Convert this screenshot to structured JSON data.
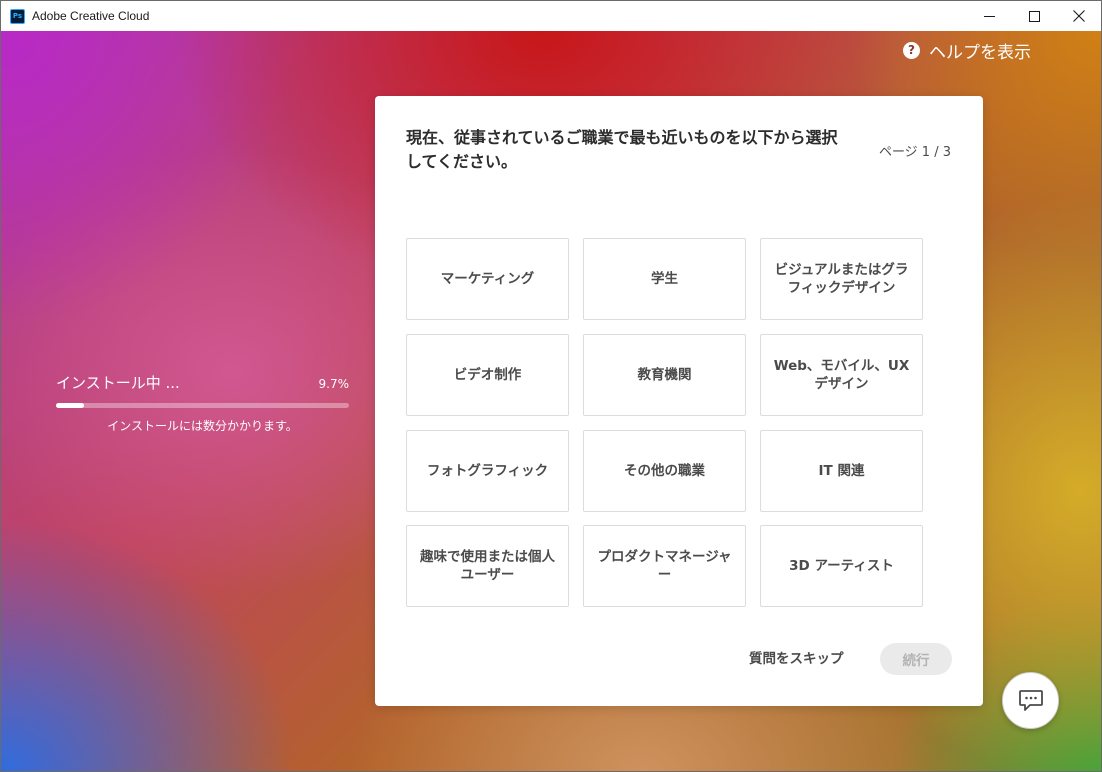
{
  "window": {
    "title": "Adobe Creative Cloud",
    "app_icon_text": "Ps"
  },
  "header": {
    "help_icon_glyph": "?",
    "help_label": "ヘルプを表示"
  },
  "install": {
    "status": "インストール中 ...",
    "percent_label": "9.7%",
    "progress": 0.097,
    "note": "インストールには数分かかります。"
  },
  "main": {
    "title": "現在、従事されているご職業で最も近いものを以下から選択してください。",
    "page_indicator": "ページ 1 / 3",
    "options": [
      {
        "label": "マーケティング"
      },
      {
        "label": "学生"
      },
      {
        "label": "ビジュアルまたはグラフィックデザイン"
      },
      {
        "label": "ビデオ制作"
      },
      {
        "label": "教育機関"
      },
      {
        "label": "Web、モバイル、UX デザイン"
      },
      {
        "label": "フォトグラフィック"
      },
      {
        "label": "その他の職業"
      },
      {
        "label": "IT 関連"
      },
      {
        "label": "趣味で使用または個人ユーザー"
      },
      {
        "label": "プロダクトマネージャー"
      },
      {
        "label": "3D アーティスト"
      }
    ],
    "skip_label": "質問をスキップ",
    "continue_label": "続行"
  },
  "icons": {
    "help": "help-icon",
    "chat": "chat-icon",
    "minimize": "minimize-icon",
    "maximize": "maximize-icon",
    "close": "close-icon"
  },
  "colors": {
    "card_background": "#ffffff",
    "option_border": "#dcdcdc",
    "text_primary": "#2c2c2c",
    "continue_disabled_bg": "#eaeaea",
    "continue_disabled_text": "#b3b3b3"
  }
}
